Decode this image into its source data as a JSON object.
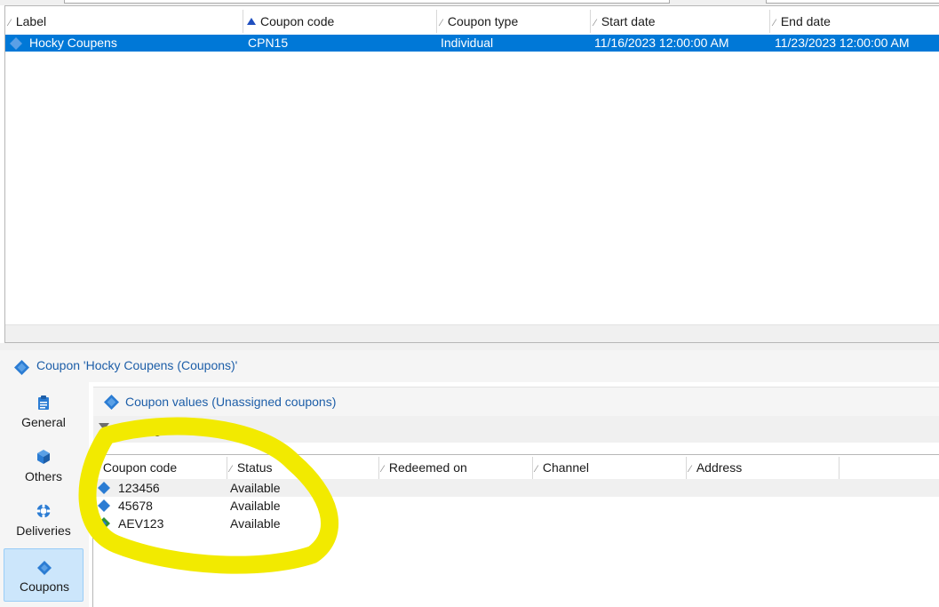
{
  "main_list": {
    "columns": [
      {
        "label": "Label",
        "sort": "none"
      },
      {
        "label": "Coupon code",
        "sort": "asc"
      },
      {
        "label": "Coupon type",
        "sort": "none"
      },
      {
        "label": "Start date",
        "sort": "none"
      },
      {
        "label": "End date",
        "sort": "none"
      }
    ],
    "rows": [
      {
        "label": "Hocky Coupens",
        "code": "CPN15",
        "type": "Individual",
        "start": "11/16/2023 12:00:00 AM",
        "end": "11/23/2023 12:00:00 AM",
        "selected": true
      }
    ]
  },
  "detail": {
    "title": "Coupon 'Hocky Coupens (Coupons)'"
  },
  "nav": {
    "items": [
      {
        "label": "General",
        "icon": "clipboard-icon",
        "active": false
      },
      {
        "label": "Others",
        "icon": "cube-icon",
        "active": false
      },
      {
        "label": "Deliveries",
        "icon": "lifebuoy-icon",
        "active": false
      },
      {
        "label": "Coupons",
        "icon": "coupon-icon",
        "active": true
      }
    ]
  },
  "panel": {
    "title": "Coupon values (Unassigned coupons)",
    "filter_label": "Unassigned coupons"
  },
  "sub_list": {
    "columns": [
      {
        "label": "Coupon code"
      },
      {
        "label": "Status"
      },
      {
        "label": "Redeemed on"
      },
      {
        "label": "Channel"
      },
      {
        "label": "Address"
      }
    ],
    "rows": [
      {
        "code": "123456",
        "status": "Available",
        "icon_color": "#2b7cd3"
      },
      {
        "code": "45678",
        "status": "Available",
        "icon_color": "#2b7cd3"
      },
      {
        "code": "AEV123",
        "status": "Available",
        "icon_color": "#2f8f3a"
      }
    ]
  },
  "colors": {
    "selection": "#0078d7",
    "link_blue": "#1d5ea8",
    "highlight": "#f2ea00"
  }
}
